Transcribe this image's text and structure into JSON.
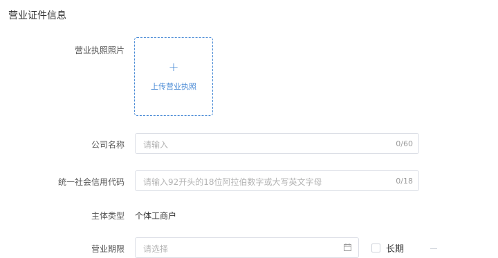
{
  "section": {
    "title": "营业证件信息"
  },
  "license_photo": {
    "label": "营业执照照片",
    "upload_text": "上传营业执照",
    "plus_icon": "plus-icon"
  },
  "company_name": {
    "label": "公司名称",
    "placeholder": "请输入",
    "counter": "0/60"
  },
  "credit_code": {
    "label": "统一社会信用代码",
    "placeholder": "请输入92开头的18位阿拉伯数字或大写英文字母",
    "counter": "0/18"
  },
  "entity_type": {
    "label": "主体类型",
    "value": "个体工商户"
  },
  "business_term": {
    "label": "营业期限",
    "placeholder": "请选择",
    "long_term_label": "长期",
    "calendar_icon": "calendar-icon"
  },
  "colors": {
    "accent": "#4a8bd6",
    "border": "#dcdfe6",
    "placeholder": "#b4b4b4"
  }
}
